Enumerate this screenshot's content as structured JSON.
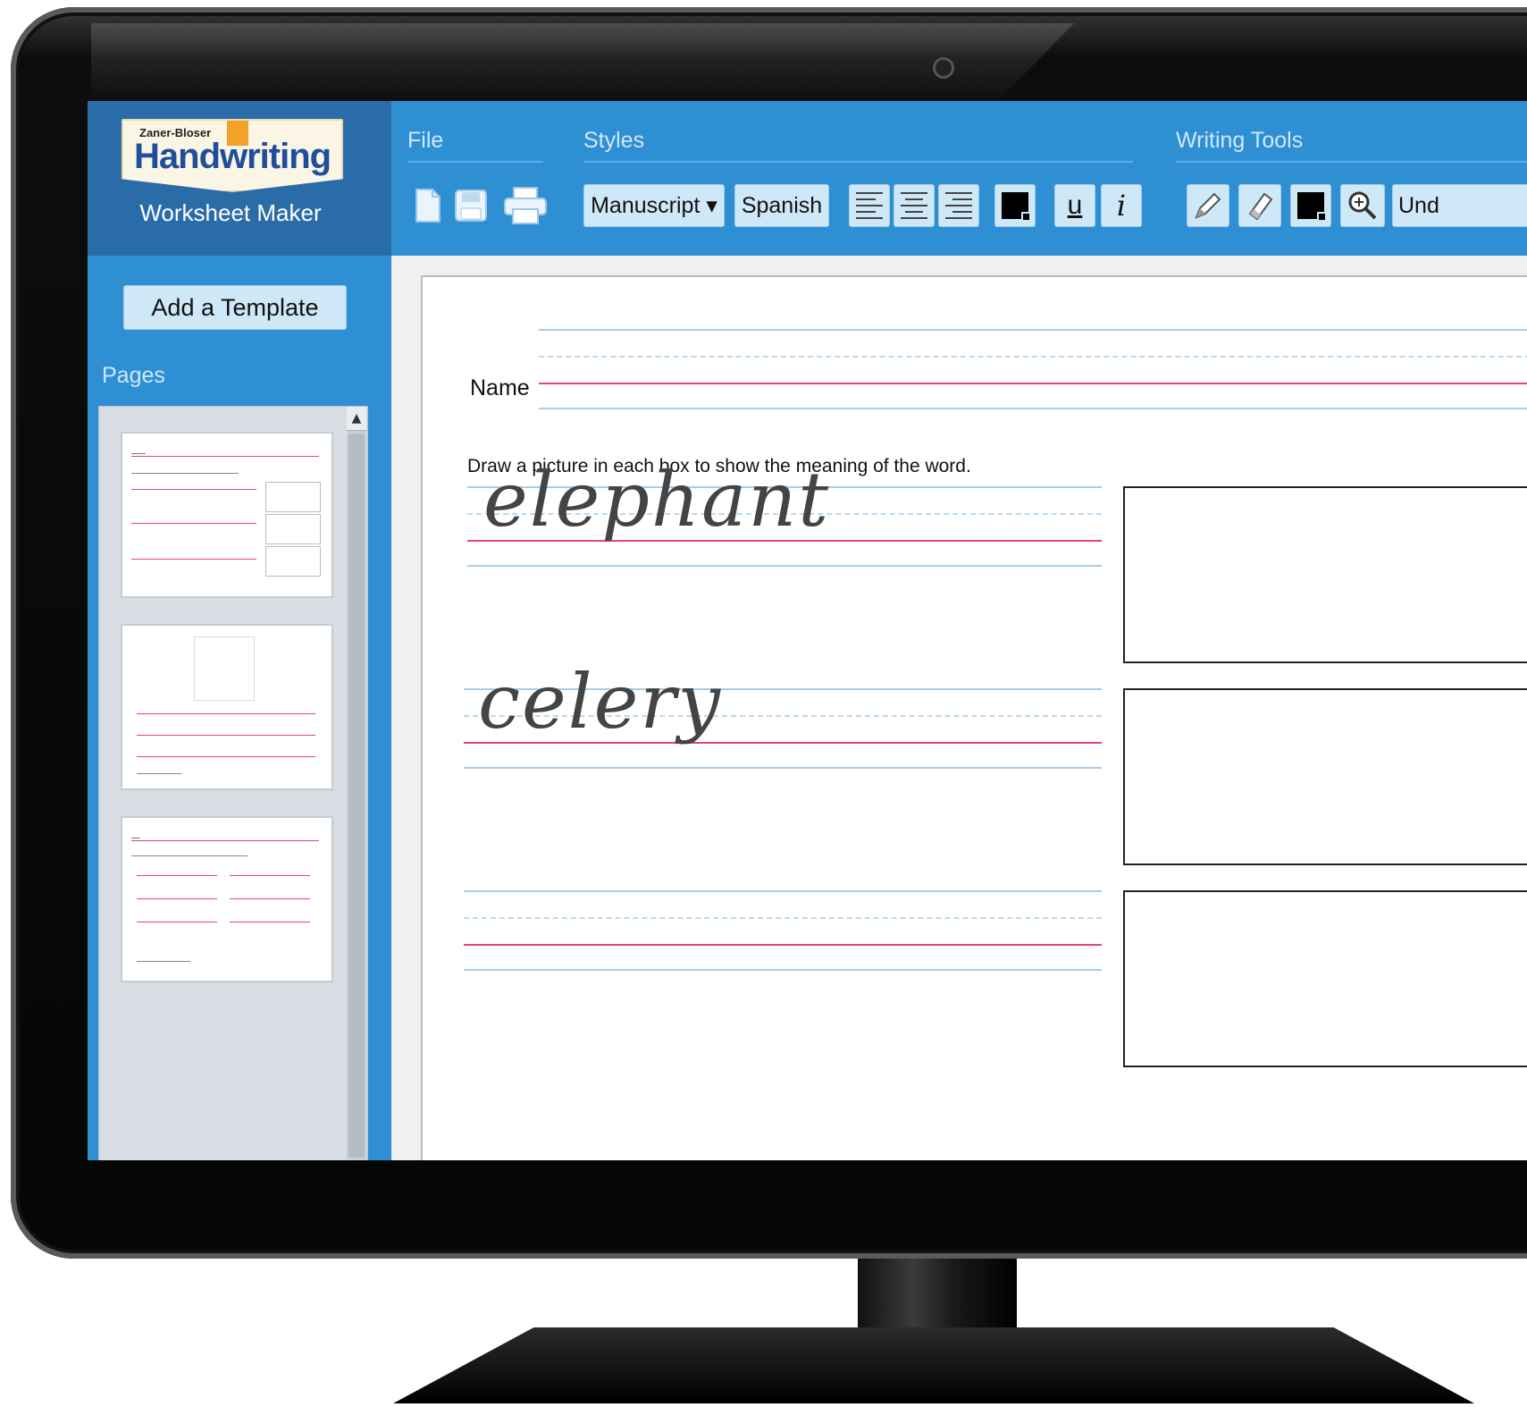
{
  "app": {
    "brand_small": "Zaner-Bloser",
    "brand_name": "Handwriting",
    "subtitle": "Worksheet Maker"
  },
  "toolbar": {
    "file_label": "File",
    "styles_label": "Styles",
    "writing_tools_label": "Writing Tools",
    "style_select": "Manuscript ▾",
    "spanish_button": "Spanish",
    "underline_glyph": "u",
    "italic_glyph": "i",
    "truncated_button": "Und",
    "icons": [
      "new-page-icon",
      "save-icon",
      "print-icon",
      "align-left-icon",
      "align-center-icon",
      "align-right-icon",
      "text-color-icon",
      "underline-icon",
      "italic-icon",
      "pencil-icon",
      "eraser-icon",
      "pen-color-icon",
      "zoom-icon"
    ],
    "colors": {
      "toolbar_bg": "#2f8fd3",
      "button_bg": "#cfe8f8",
      "brand_panel": "#2a6ca8"
    }
  },
  "sidebar": {
    "add_template_label": "Add a Template",
    "pages_label": "Pages",
    "page_count_visible": 3
  },
  "worksheet": {
    "name_label": "Name",
    "instructions": "Draw a picture in each box to show the meaning of the word.",
    "words": [
      "elephant",
      "celery",
      ""
    ],
    "guide_colors": {
      "solid": "#a6cde9",
      "dashed": "#b7d9f1",
      "baseline": "#e6457a"
    }
  }
}
